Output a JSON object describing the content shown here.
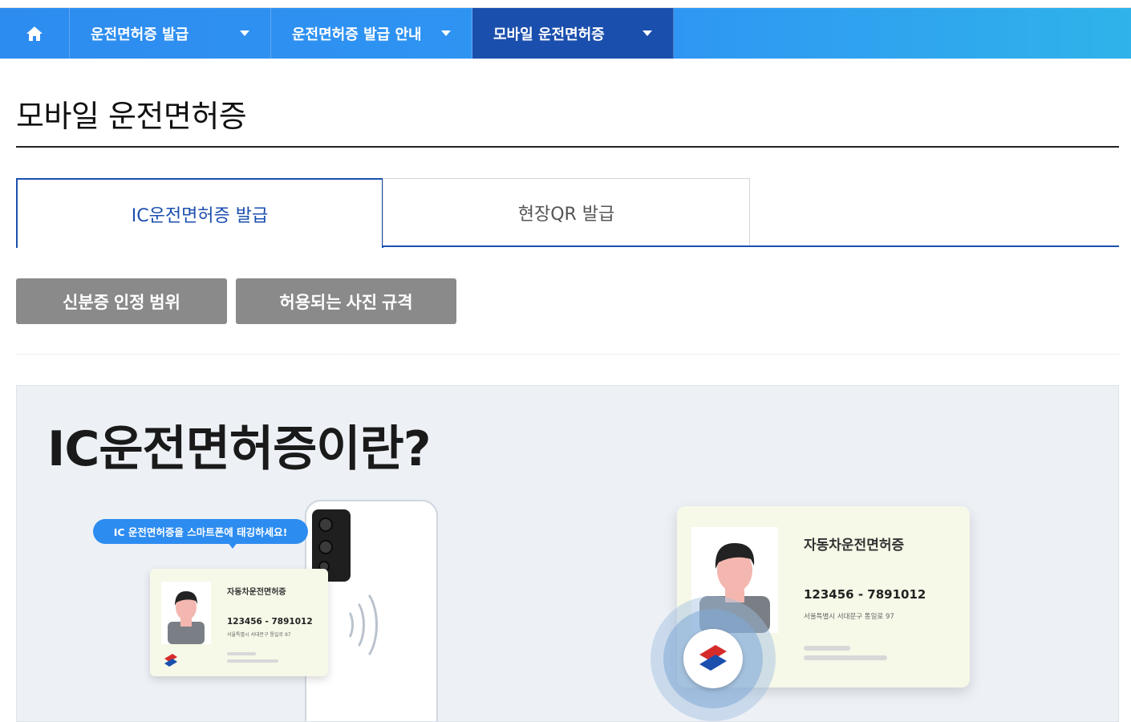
{
  "nav": {
    "home_icon": "home-icon",
    "items": [
      {
        "label": "운전면허증 발급",
        "active": false
      },
      {
        "label": "운전면허증 발급 안내",
        "active": false
      },
      {
        "label": "모바일 운전면허증",
        "active": true
      }
    ]
  },
  "page": {
    "title": "모바일 운전면허증"
  },
  "tabs": [
    {
      "label": "IC운전면허증 발급",
      "active": true
    },
    {
      "label": "현장QR 발급",
      "active": false
    }
  ],
  "buttons": {
    "id_scope": "신분증 인정 범위",
    "photo_spec": "허용되는 사진 규격"
  },
  "banner": {
    "title": "IC운전면허증이란?",
    "bubble_text": "IC 운전면허증을 스마트폰에 태깅하세요!",
    "card": {
      "title": "자동차운전면허증",
      "number": "123456 - 7891012",
      "address": "서울특별시 서대문구 통일로 97"
    }
  },
  "colors": {
    "nav_active": "#1b4fae",
    "nav_bg": "#2d8cf0",
    "tab_active": "#1b4fae",
    "button_gray": "#8a8a8a"
  }
}
